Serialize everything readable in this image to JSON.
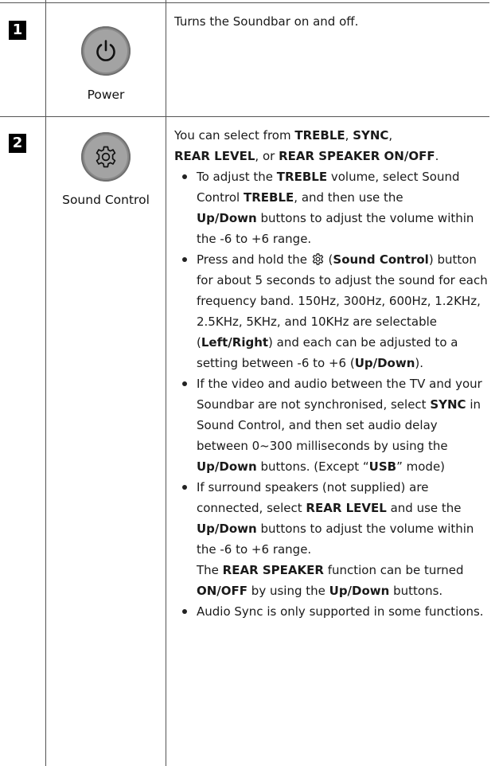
{
  "rows": [
    {
      "number": "1",
      "icon": "power-icon",
      "label": "Power",
      "text": "Turns the Soundbar on and off."
    },
    {
      "number": "2",
      "icon": "sound-control-gear-icon",
      "label": "Sound Control",
      "intro": {
        "p1": "You can select from ",
        "treble": "TREBLE",
        "s1": ", ",
        "sync": "SYNC",
        "s2": ",",
        "rearlevel": "REAR LEVEL",
        "s3": ", or ",
        "rearspeaker": "REAR SPEAKER ON/OFF",
        "s4": "."
      },
      "bullets": [
        {
          "a": "To adjust the ",
          "b": "TREBLE",
          "c": " volume, select Sound Control ",
          "d": "TREBLE",
          "e": ", and then use the ",
          "f": "Up/Down",
          "g": " buttons to adjust the volume within the -6 to +6 range."
        },
        {
          "a": "Press and hold the ",
          "icon": "sound-control-gear-icon",
          "b": " (",
          "c": "Sound Control",
          "d": ") button for about 5 seconds to adjust the sound for each frequency band. 150Hz, 300Hz, 600Hz, 1.2KHz, 2.5KHz, 5KHz, and 10KHz are selectable (",
          "e": "Left/Right",
          "f": ") and each can be adjusted to a setting between -6 to +6 (",
          "g": "Up/Down",
          "h": ")."
        },
        {
          "a": "If the video and audio between the TV and your Soundbar are not synchronised, select ",
          "b": "SYNC",
          "c": " in Sound Control, and then set audio delay between 0~300 milliseconds by using the ",
          "d": "Up/Down",
          "e": " buttons. (Except “",
          "f": "USB",
          "g": "” mode)"
        },
        {
          "a": "If surround speakers (not supplied) are connected, select ",
          "b": "REAR LEVEL",
          "c": " and use the ",
          "d": "Up/Down",
          "e": " buttons to adjust the volume within the -6 to +6 range.",
          "f": "The ",
          "g": "REAR SPEAKER",
          "h": " function can be turned ",
          "i": "ON/OFF",
          "j": " by using the ",
          "k": "Up/Down",
          "l": " buttons."
        },
        {
          "a": "Audio Sync is only supported in some functions."
        }
      ]
    }
  ]
}
